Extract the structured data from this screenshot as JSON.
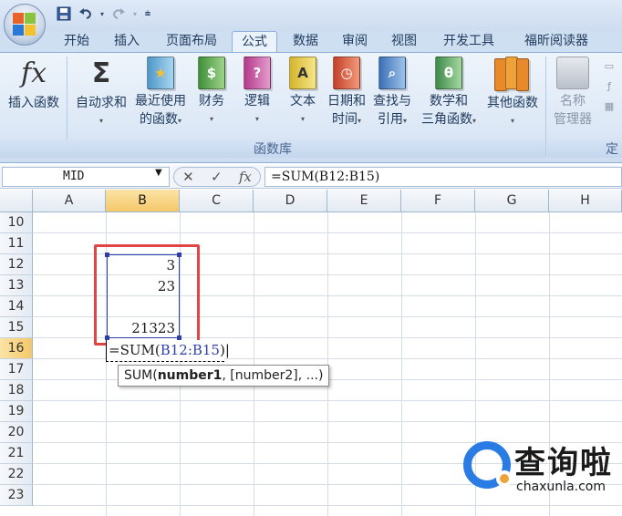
{
  "quick_access": {
    "save_icon": "save-icon",
    "undo_icon": "undo-icon",
    "redo_icon": "redo-icon",
    "customize_icon": "customize-icon"
  },
  "tabs": [
    "开始",
    "插入",
    "页面布局",
    "公式",
    "数据",
    "审阅",
    "视图",
    "开发工具",
    "福昕阅读器"
  ],
  "active_tab": "公式",
  "ribbon": {
    "insert_function": "插入函数",
    "autosum": "自动求和",
    "recent": [
      "最近使用",
      "的函数"
    ],
    "financial": "财务",
    "logical": "逻辑",
    "text": "文本",
    "datetime": [
      "日期和",
      "时间"
    ],
    "lookup": [
      "查找与",
      "引用"
    ],
    "math": [
      "数学和",
      "三角函数"
    ],
    "more": "其他函数",
    "name_manager": [
      "名称",
      "管理器"
    ],
    "group_label": "函数库",
    "group_label2": "定",
    "fx_glyph": "fx",
    "sigma_glyph": "Σ",
    "book_glyphs": [
      "?",
      "A",
      "θ"
    ]
  },
  "formula_bar": {
    "name_box": "MID",
    "fx_label": "fx",
    "cancel": "✕",
    "enter": "✓",
    "formula": "=SUM(B12:B15)"
  },
  "columns": [
    "A",
    "B",
    "C",
    "D",
    "E",
    "F",
    "G",
    "H"
  ],
  "rows": [
    "10",
    "11",
    "12",
    "13",
    "14",
    "15",
    "16",
    "17",
    "18",
    "19",
    "20",
    "21",
    "22",
    "23"
  ],
  "cells": {
    "B12": "3",
    "B13": "23",
    "B15": "21323"
  },
  "edit": {
    "prefix": "=SUM(",
    "ref": "B12:B15",
    "suffix": ")"
  },
  "tooltip": {
    "fn": "SUM(",
    "bold": "number1",
    "rest": ", [number2], ...)"
  },
  "watermark": {
    "text": "查询啦",
    "sub": "chaxunla.com"
  },
  "colors": {
    "accent": "#2f3fa8",
    "highlight": "#e24444",
    "ribbon_bg": "#dce8f6",
    "selected_header": "#f5c868"
  }
}
